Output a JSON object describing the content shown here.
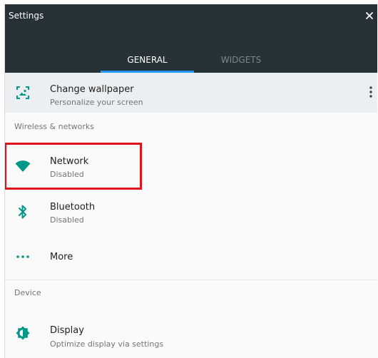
{
  "window": {
    "title": "Settings",
    "close_icon": "close-icon"
  },
  "tabs": [
    {
      "label": "GENERAL",
      "selected": true
    },
    {
      "label": "WIDGETS",
      "selected": false
    }
  ],
  "colors": {
    "header_background": "#263238",
    "tab_indicator": "#2196f3",
    "accent_icons": "#009688",
    "highlight_box": "#e1121b",
    "wallpaper_row_background": "#eceff1"
  },
  "wallpaper": {
    "title": "Change wallpaper",
    "subtitle": "Personalize your screen",
    "icon": "wallpaper-icon",
    "menu_icon": "overflow-menu-icon"
  },
  "sections": [
    {
      "header": "Wireless & networks",
      "items": [
        {
          "title": "Network",
          "subtitle": "Disabled",
          "icon": "wifi-icon",
          "highlighted": true
        },
        {
          "title": "Bluetooth",
          "subtitle": "Disabled",
          "icon": "bluetooth-icon"
        },
        {
          "title": "More",
          "icon": "more-horizontal-icon"
        }
      ]
    },
    {
      "header": "Device",
      "items": [
        {
          "title": "Display",
          "subtitle": "Optimize display via settings",
          "icon": "brightness-icon"
        }
      ]
    }
  ]
}
